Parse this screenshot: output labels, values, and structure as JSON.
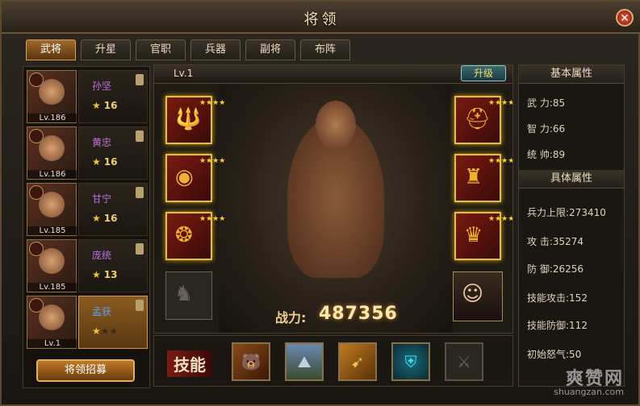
{
  "window": {
    "title": "将领",
    "close_icon": "close-icon"
  },
  "tabs": [
    "武将",
    "升星",
    "官职",
    "兵器",
    "副将",
    "布阵"
  ],
  "generals": [
    {
      "level": "Lv.186",
      "name": "孙坚",
      "stars": "★",
      "star_count": "16",
      "mark_icon": "horse-icon"
    },
    {
      "level": "Lv.186",
      "name": "黄忠",
      "stars": "★",
      "star_count": "16",
      "mark_icon": "bow-icon"
    },
    {
      "level": "Lv.185",
      "name": "甘宁",
      "stars": "★",
      "star_count": "16",
      "mark_icon": "shield-icon"
    },
    {
      "level": "Lv.185",
      "name": "庞统",
      "stars": "★",
      "star_count": "13",
      "mark_icon": "shield-icon"
    },
    {
      "level": "Lv.1",
      "name": "孟获",
      "stars": "★★★",
      "star_count": "",
      "mark_icon": "shield-icon"
    }
  ],
  "recruit_button": "将领招募",
  "hero": {
    "level": "Lv.1",
    "upgrade_label": "升级",
    "power_label": "战力:",
    "power_value": "487356"
  },
  "equip_left": [
    {
      "icon": "trident-icon",
      "stars": "★★★★"
    },
    {
      "icon": "cup-icon",
      "stars": "★★★★"
    },
    {
      "icon": "dragon-icon",
      "stars": "★★★★"
    },
    {
      "icon": "horse-icon",
      "stars": ""
    }
  ],
  "equip_right": [
    {
      "icon": "helmet-icon",
      "stars": "★★★★"
    },
    {
      "icon": "armor-icon",
      "stars": "★★★★"
    },
    {
      "icon": "boots-icon",
      "stars": "★★★★"
    },
    {
      "icon": "vice-general-portrait",
      "stars": ""
    }
  ],
  "skills": {
    "label": "技能",
    "items": [
      {
        "icon": "beast-icon",
        "color": "#c07030"
      },
      {
        "icon": "mountain-icon",
        "color": "#5a8ab0"
      },
      {
        "icon": "bow-icon",
        "color": "#d89040"
      },
      {
        "icon": "shield-icon",
        "color": "#30b0c0"
      },
      {
        "icon": "locked-skill-icon",
        "color": "#6a6258"
      }
    ]
  },
  "basic_attrs": {
    "title": "基本属性",
    "items": [
      {
        "label": "武 力:",
        "value": "85"
      },
      {
        "label": "智 力:",
        "value": "66"
      },
      {
        "label": "统 帅:",
        "value": "89"
      }
    ]
  },
  "detail_attrs": {
    "title": "具体属性",
    "items": [
      {
        "label": "兵力上限:",
        "value": "273410"
      },
      {
        "label": "攻    击:",
        "value": "35274"
      },
      {
        "label": "防    御:",
        "value": "26256"
      },
      {
        "label": "技能攻击:",
        "value": "152"
      },
      {
        "label": "技能防御:",
        "value": "112"
      },
      {
        "label": "初始怒气:",
        "value": "50"
      }
    ]
  },
  "watermark": {
    "cn": "爽赞网",
    "en": "shuangzan.com"
  }
}
